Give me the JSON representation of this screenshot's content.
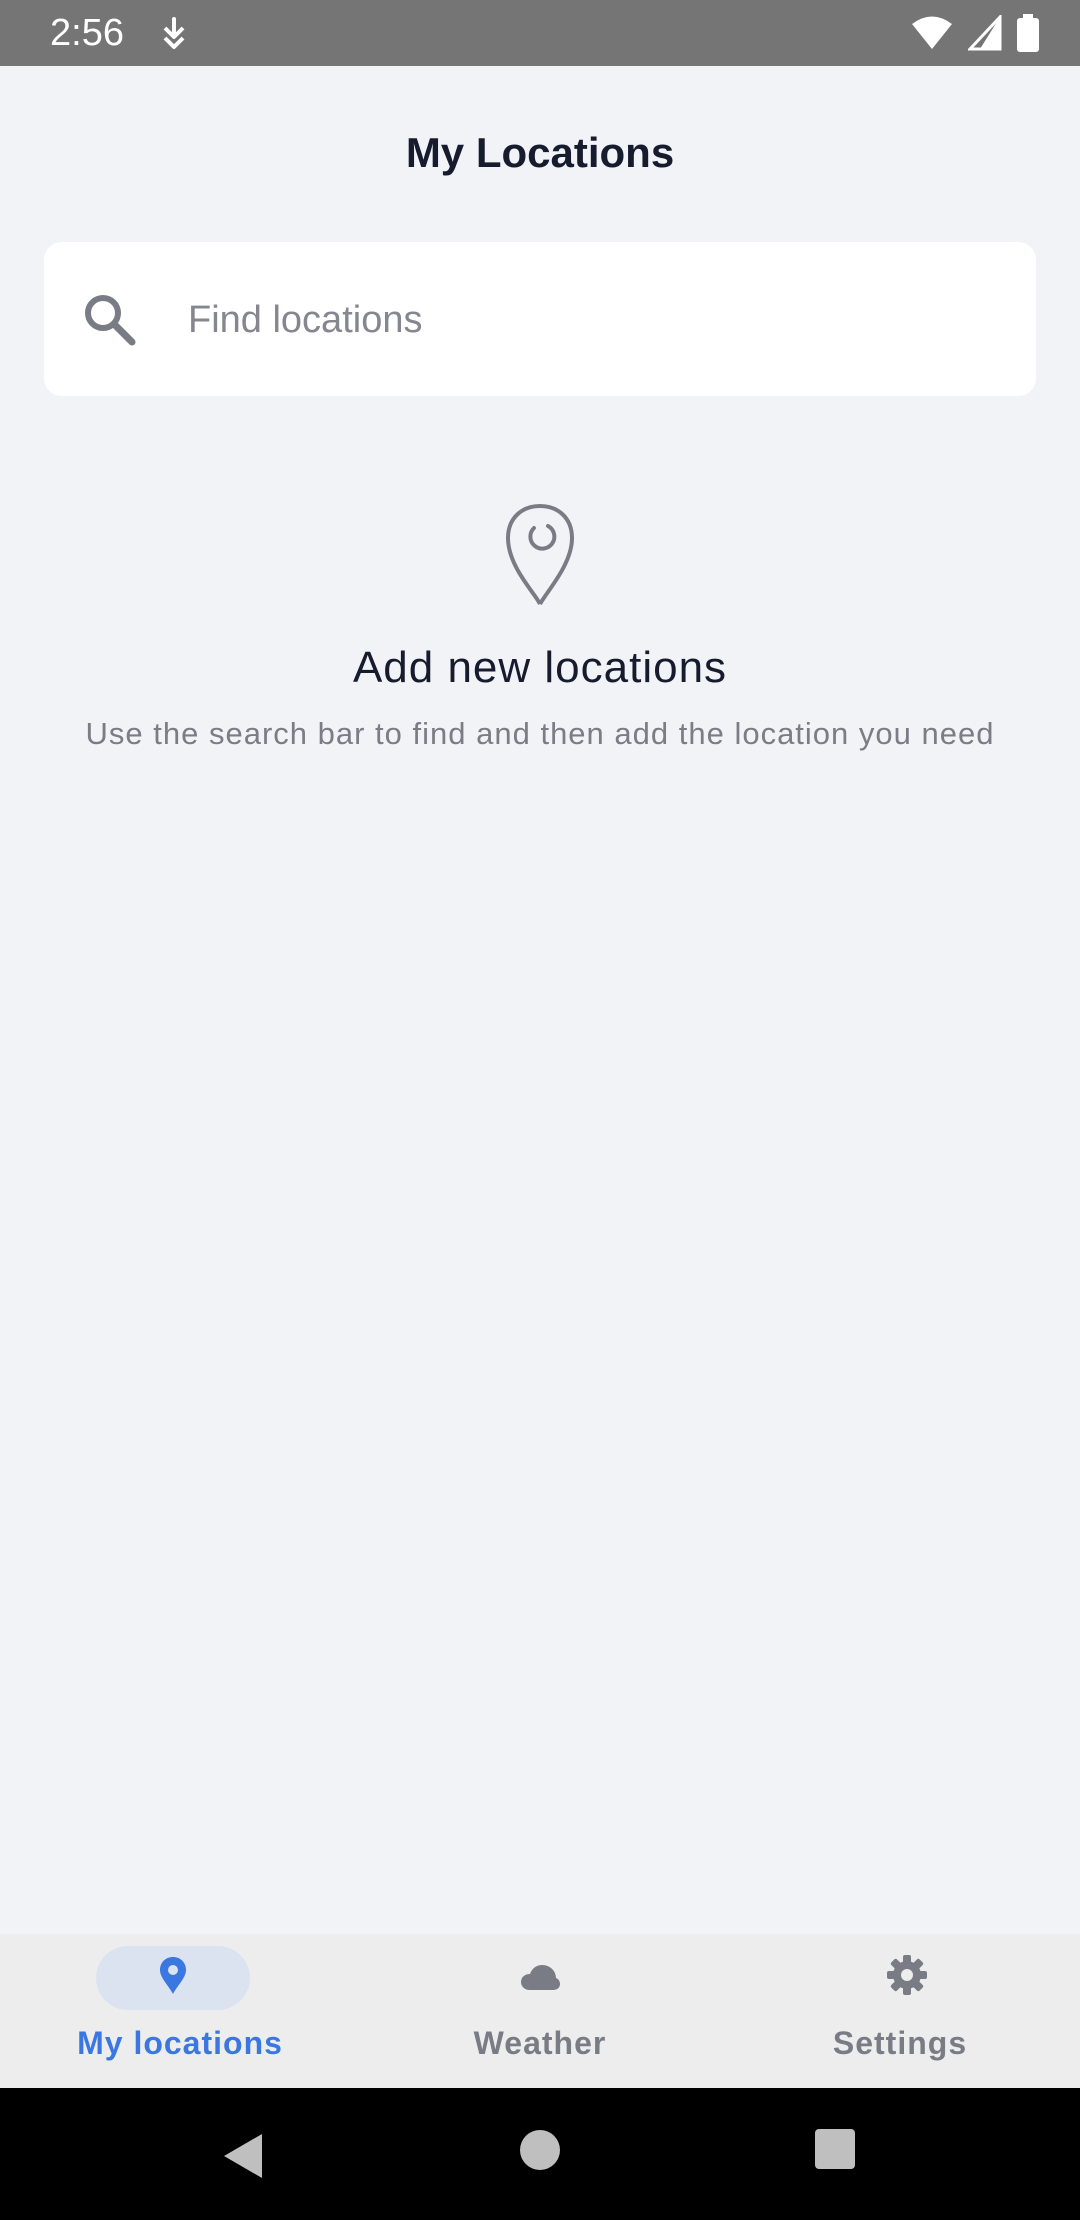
{
  "status_bar": {
    "time": "2:56"
  },
  "header": {
    "title": "My Locations"
  },
  "search": {
    "placeholder": "Find locations",
    "value": ""
  },
  "empty_state": {
    "title": "Add new locations",
    "subtitle": "Use the search bar to find and then add the location you need"
  },
  "bottom_nav": {
    "items": [
      {
        "label": "My locations",
        "icon": "location-pin-icon",
        "selected": true
      },
      {
        "label": "Weather",
        "icon": "cloud-icon",
        "selected": false
      },
      {
        "label": "Settings",
        "icon": "gear-icon",
        "selected": false
      }
    ]
  },
  "colors": {
    "background": "#f1f3f7",
    "accent": "#3b77e0",
    "text_primary": "#161b2e",
    "text_secondary": "#7b7d86",
    "nav_inactive": "#7a7c85",
    "nav_pill": "#dbe3f1",
    "nav_background": "#ededee",
    "status_bar": "#757575"
  }
}
